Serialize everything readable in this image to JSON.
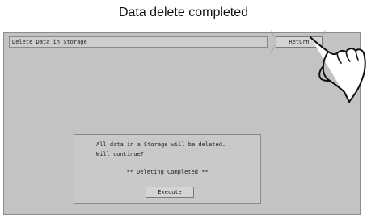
{
  "caption": "Data delete completed",
  "screen": {
    "title": "Delete Data in Storage",
    "return_label": "Return"
  },
  "dialog": {
    "line1": "All data in a Storage will be deleted.",
    "line2": "Will continue?",
    "status": "** Deleting Completed **",
    "execute_label": "Execute"
  },
  "icons": {
    "hand": "pointing-hand-icon",
    "tap": "tap-spark-icon"
  }
}
